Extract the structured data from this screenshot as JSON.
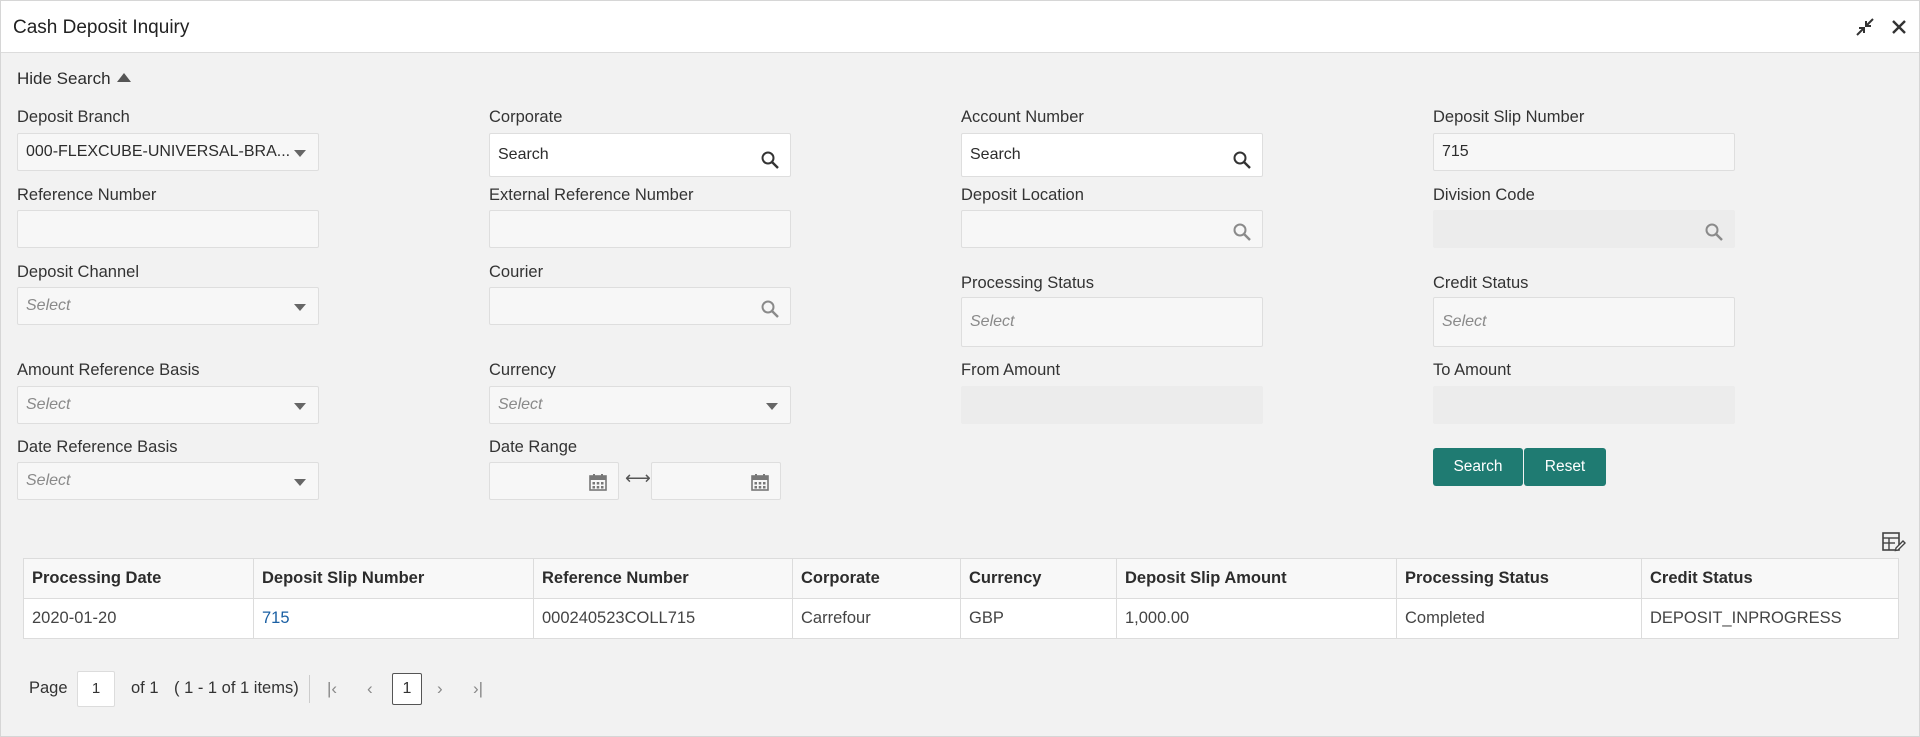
{
  "window": {
    "title": "Cash Deposit Inquiry"
  },
  "search_toggle": "Hide Search",
  "form": {
    "deposit_branch": {
      "label": "Deposit Branch",
      "value": "000-FLEXCUBE-UNIVERSAL-BRA..."
    },
    "corporate": {
      "label": "Corporate",
      "value": "Search"
    },
    "account_number": {
      "label": "Account Number",
      "value": "Search"
    },
    "deposit_slip_number": {
      "label": "Deposit Slip Number",
      "value": "715"
    },
    "reference_number": {
      "label": "Reference Number",
      "value": ""
    },
    "external_reference_number": {
      "label": "External Reference Number",
      "value": ""
    },
    "deposit_location": {
      "label": "Deposit Location",
      "value": ""
    },
    "division_code": {
      "label": "Division Code",
      "value": ""
    },
    "deposit_channel": {
      "label": "Deposit Channel",
      "placeholder": "Select"
    },
    "courier": {
      "label": "Courier",
      "value": ""
    },
    "processing_status": {
      "label": "Processing Status",
      "placeholder": "Select"
    },
    "credit_status": {
      "label": "Credit Status",
      "placeholder": "Select"
    },
    "amount_reference_basis": {
      "label": "Amount Reference Basis",
      "placeholder": "Select"
    },
    "currency": {
      "label": "Currency",
      "placeholder": "Select"
    },
    "from_amount": {
      "label": "From Amount",
      "value": ""
    },
    "to_amount": {
      "label": "To Amount",
      "value": ""
    },
    "date_reference_basis": {
      "label": "Date Reference Basis",
      "placeholder": "Select"
    },
    "date_range": {
      "label": "Date Range",
      "from": "",
      "to": ""
    }
  },
  "buttons": {
    "search": "Search",
    "reset": "Reset"
  },
  "table": {
    "columns": [
      "Processing Date",
      "Deposit Slip Number",
      "Reference Number",
      "Corporate",
      "Currency",
      "Deposit Slip Amount",
      "Processing Status",
      "Credit Status"
    ],
    "rows": [
      [
        "2020-01-20",
        "715",
        "000240523COLL715",
        "Carrefour",
        "GBP",
        "1,000.00",
        "Completed",
        "DEPOSIT_INPROGRESS"
      ]
    ]
  },
  "pagination": {
    "page_label": "Page",
    "current_page": "1",
    "of_label": "of 1",
    "items_summary": "( 1 - 1 of 1 items)",
    "active_page": "1"
  },
  "colors": {
    "accent": "#1f7b72",
    "link": "#1a5fa3",
    "background": "#f2f2f2"
  }
}
